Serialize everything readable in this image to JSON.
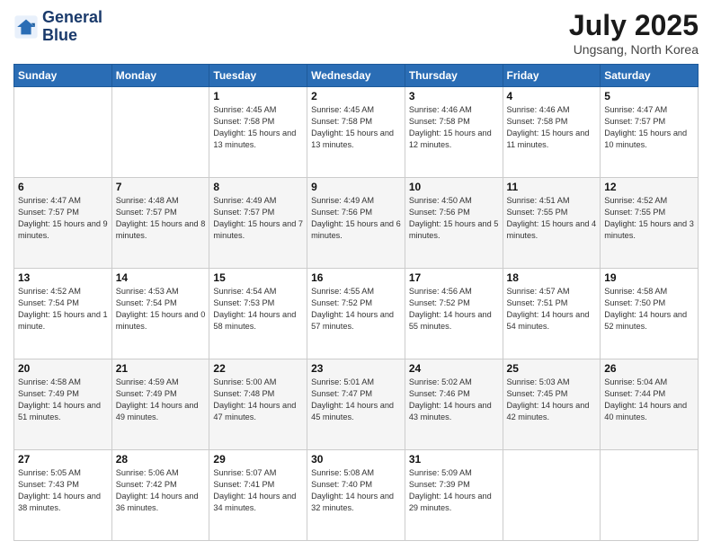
{
  "logo": {
    "line1": "General",
    "line2": "Blue"
  },
  "title": "July 2025",
  "location": "Ungsang, North Korea",
  "weekdays": [
    "Sunday",
    "Monday",
    "Tuesday",
    "Wednesday",
    "Thursday",
    "Friday",
    "Saturday"
  ],
  "weeks": [
    [
      {
        "day": "",
        "sunrise": "",
        "sunset": "",
        "daylight": ""
      },
      {
        "day": "",
        "sunrise": "",
        "sunset": "",
        "daylight": ""
      },
      {
        "day": "1",
        "sunrise": "Sunrise: 4:45 AM",
        "sunset": "Sunset: 7:58 PM",
        "daylight": "Daylight: 15 hours and 13 minutes."
      },
      {
        "day": "2",
        "sunrise": "Sunrise: 4:45 AM",
        "sunset": "Sunset: 7:58 PM",
        "daylight": "Daylight: 15 hours and 13 minutes."
      },
      {
        "day": "3",
        "sunrise": "Sunrise: 4:46 AM",
        "sunset": "Sunset: 7:58 PM",
        "daylight": "Daylight: 15 hours and 12 minutes."
      },
      {
        "day": "4",
        "sunrise": "Sunrise: 4:46 AM",
        "sunset": "Sunset: 7:58 PM",
        "daylight": "Daylight: 15 hours and 11 minutes."
      },
      {
        "day": "5",
        "sunrise": "Sunrise: 4:47 AM",
        "sunset": "Sunset: 7:57 PM",
        "daylight": "Daylight: 15 hours and 10 minutes."
      }
    ],
    [
      {
        "day": "6",
        "sunrise": "Sunrise: 4:47 AM",
        "sunset": "Sunset: 7:57 PM",
        "daylight": "Daylight: 15 hours and 9 minutes."
      },
      {
        "day": "7",
        "sunrise": "Sunrise: 4:48 AM",
        "sunset": "Sunset: 7:57 PM",
        "daylight": "Daylight: 15 hours and 8 minutes."
      },
      {
        "day": "8",
        "sunrise": "Sunrise: 4:49 AM",
        "sunset": "Sunset: 7:57 PM",
        "daylight": "Daylight: 15 hours and 7 minutes."
      },
      {
        "day": "9",
        "sunrise": "Sunrise: 4:49 AM",
        "sunset": "Sunset: 7:56 PM",
        "daylight": "Daylight: 15 hours and 6 minutes."
      },
      {
        "day": "10",
        "sunrise": "Sunrise: 4:50 AM",
        "sunset": "Sunset: 7:56 PM",
        "daylight": "Daylight: 15 hours and 5 minutes."
      },
      {
        "day": "11",
        "sunrise": "Sunrise: 4:51 AM",
        "sunset": "Sunset: 7:55 PM",
        "daylight": "Daylight: 15 hours and 4 minutes."
      },
      {
        "day": "12",
        "sunrise": "Sunrise: 4:52 AM",
        "sunset": "Sunset: 7:55 PM",
        "daylight": "Daylight: 15 hours and 3 minutes."
      }
    ],
    [
      {
        "day": "13",
        "sunrise": "Sunrise: 4:52 AM",
        "sunset": "Sunset: 7:54 PM",
        "daylight": "Daylight: 15 hours and 1 minute."
      },
      {
        "day": "14",
        "sunrise": "Sunrise: 4:53 AM",
        "sunset": "Sunset: 7:54 PM",
        "daylight": "Daylight: 15 hours and 0 minutes."
      },
      {
        "day": "15",
        "sunrise": "Sunrise: 4:54 AM",
        "sunset": "Sunset: 7:53 PM",
        "daylight": "Daylight: 14 hours and 58 minutes."
      },
      {
        "day": "16",
        "sunrise": "Sunrise: 4:55 AM",
        "sunset": "Sunset: 7:52 PM",
        "daylight": "Daylight: 14 hours and 57 minutes."
      },
      {
        "day": "17",
        "sunrise": "Sunrise: 4:56 AM",
        "sunset": "Sunset: 7:52 PM",
        "daylight": "Daylight: 14 hours and 55 minutes."
      },
      {
        "day": "18",
        "sunrise": "Sunrise: 4:57 AM",
        "sunset": "Sunset: 7:51 PM",
        "daylight": "Daylight: 14 hours and 54 minutes."
      },
      {
        "day": "19",
        "sunrise": "Sunrise: 4:58 AM",
        "sunset": "Sunset: 7:50 PM",
        "daylight": "Daylight: 14 hours and 52 minutes."
      }
    ],
    [
      {
        "day": "20",
        "sunrise": "Sunrise: 4:58 AM",
        "sunset": "Sunset: 7:49 PM",
        "daylight": "Daylight: 14 hours and 51 minutes."
      },
      {
        "day": "21",
        "sunrise": "Sunrise: 4:59 AM",
        "sunset": "Sunset: 7:49 PM",
        "daylight": "Daylight: 14 hours and 49 minutes."
      },
      {
        "day": "22",
        "sunrise": "Sunrise: 5:00 AM",
        "sunset": "Sunset: 7:48 PM",
        "daylight": "Daylight: 14 hours and 47 minutes."
      },
      {
        "day": "23",
        "sunrise": "Sunrise: 5:01 AM",
        "sunset": "Sunset: 7:47 PM",
        "daylight": "Daylight: 14 hours and 45 minutes."
      },
      {
        "day": "24",
        "sunrise": "Sunrise: 5:02 AM",
        "sunset": "Sunset: 7:46 PM",
        "daylight": "Daylight: 14 hours and 43 minutes."
      },
      {
        "day": "25",
        "sunrise": "Sunrise: 5:03 AM",
        "sunset": "Sunset: 7:45 PM",
        "daylight": "Daylight: 14 hours and 42 minutes."
      },
      {
        "day": "26",
        "sunrise": "Sunrise: 5:04 AM",
        "sunset": "Sunset: 7:44 PM",
        "daylight": "Daylight: 14 hours and 40 minutes."
      }
    ],
    [
      {
        "day": "27",
        "sunrise": "Sunrise: 5:05 AM",
        "sunset": "Sunset: 7:43 PM",
        "daylight": "Daylight: 14 hours and 38 minutes."
      },
      {
        "day": "28",
        "sunrise": "Sunrise: 5:06 AM",
        "sunset": "Sunset: 7:42 PM",
        "daylight": "Daylight: 14 hours and 36 minutes."
      },
      {
        "day": "29",
        "sunrise": "Sunrise: 5:07 AM",
        "sunset": "Sunset: 7:41 PM",
        "daylight": "Daylight: 14 hours and 34 minutes."
      },
      {
        "day": "30",
        "sunrise": "Sunrise: 5:08 AM",
        "sunset": "Sunset: 7:40 PM",
        "daylight": "Daylight: 14 hours and 32 minutes."
      },
      {
        "day": "31",
        "sunrise": "Sunrise: 5:09 AM",
        "sunset": "Sunset: 7:39 PM",
        "daylight": "Daylight: 14 hours and 29 minutes."
      },
      {
        "day": "",
        "sunrise": "",
        "sunset": "",
        "daylight": ""
      },
      {
        "day": "",
        "sunrise": "",
        "sunset": "",
        "daylight": ""
      }
    ]
  ]
}
